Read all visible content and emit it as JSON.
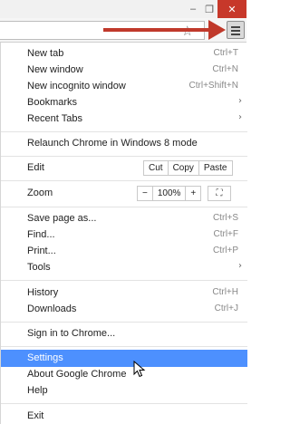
{
  "window": {
    "minimize_glyph": "–",
    "restore_glyph": "❐",
    "close_glyph": "✕"
  },
  "toolbar": {
    "star_icon": "☆",
    "menu_icon": "hamburger-menu-icon"
  },
  "annotation": {
    "arrow_color": "#c0392b"
  },
  "menu": {
    "new_tab": {
      "label": "New tab",
      "shortcut": "Ctrl+T"
    },
    "new_window": {
      "label": "New window",
      "shortcut": "Ctrl+N"
    },
    "new_incognito": {
      "label": "New incognito window",
      "shortcut": "Ctrl+Shift+N"
    },
    "bookmarks": {
      "label": "Bookmarks"
    },
    "recent_tabs": {
      "label": "Recent Tabs"
    },
    "relaunch": {
      "label": "Relaunch Chrome in Windows 8 mode"
    },
    "edit": {
      "label": "Edit",
      "cut": "Cut",
      "copy": "Copy",
      "paste": "Paste"
    },
    "zoom": {
      "label": "Zoom",
      "minus": "−",
      "level": "100%",
      "plus": "+",
      "fullscreen": "⛶"
    },
    "save_page": {
      "label": "Save page as...",
      "shortcut": "Ctrl+S"
    },
    "find": {
      "label": "Find...",
      "shortcut": "Ctrl+F"
    },
    "print": {
      "label": "Print...",
      "shortcut": "Ctrl+P"
    },
    "tools": {
      "label": "Tools"
    },
    "history": {
      "label": "History",
      "shortcut": "Ctrl+H"
    },
    "downloads": {
      "label": "Downloads",
      "shortcut": "Ctrl+J"
    },
    "sign_in": {
      "label": "Sign in to Chrome..."
    },
    "settings": {
      "label": "Settings"
    },
    "about": {
      "label": "About Google Chrome"
    },
    "help": {
      "label": "Help"
    },
    "exit": {
      "label": "Exit"
    },
    "submenu_arrow": "›",
    "highlight_color": "#4d90fe"
  }
}
